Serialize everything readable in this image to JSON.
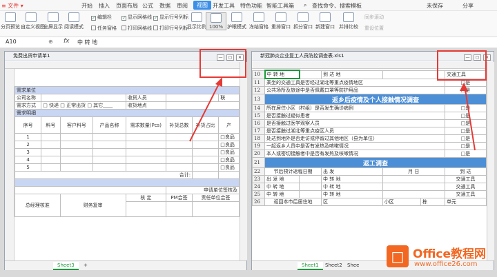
{
  "menubar": {
    "items": [
      "开始",
      "插入",
      "页面布局",
      "公式",
      "数据",
      "审阅",
      "视图",
      "开发工具",
      "特色功能",
      "智能工具箱"
    ],
    "active": "视图",
    "search": "查找命令、搜索模板",
    "status": "未保存",
    "share": "分享"
  },
  "ribbon": {
    "buttons": [
      "分页预览",
      "自定义视图",
      "全屏显示",
      "阅读模式",
      "护眼模式",
      "冻结窗格",
      "重排窗口",
      "拆分窗口",
      "新建窗口",
      "并排比较"
    ],
    "checks": [
      "编辑栏",
      "显示网格线",
      "显示行号列标",
      "任务窗格",
      "打印网格线",
      "打印行号列标"
    ],
    "zoom": "100%",
    "zoom_label": "显示比例",
    "sync": "同步滚动",
    "reset": "重设位置"
  },
  "formula": {
    "cell": "A10",
    "fx": "fx",
    "value": "中 转 地"
  },
  "left": {
    "title": "免费出货申请单1",
    "tab": "Sheet3",
    "cols": [
      "A",
      "B",
      "C",
      "D",
      "E",
      "F",
      "G",
      "H"
    ],
    "section1": "需求单位",
    "company": "公司名称",
    "recv": "收货人员",
    "contact": "联",
    "demand": "需求方式",
    "demand_opts": "□ 快递  □ 正常出货  □ 其它____",
    "addr": "收货地点",
    "section2": "需求明细",
    "heads": [
      "序号",
      "料号",
      "客户料号",
      "产品名称",
      "需求数量(Pcs)",
      "补货总数",
      "补货占比",
      "产"
    ],
    "rows": [
      "1",
      "2",
      "3",
      "4",
      "5"
    ],
    "good": "□良品",
    "total": "合计:",
    "sign": "申请单位签核及",
    "gm": "总经理核准",
    "fin": "财务复审",
    "check": "核 定",
    "pm": "PM会签",
    "resp": "责任单位会签"
  },
  "right": {
    "title": "新冠肺炎企业复工人员防控调查表.xls1",
    "tabs": [
      "Sheet1",
      "Sheet2",
      "Shee"
    ],
    "cols": [
      "C",
      "D",
      "E",
      "F",
      "G",
      "H",
      "I",
      "J"
    ],
    "r10": [
      "中 转 地",
      "到 达 地",
      "交通工具"
    ],
    "rows": [
      {
        "n": "11",
        "t": "乘坐的交通工具是否经过湖北等重点疫情地区",
        "c": "□是"
      },
      {
        "n": "12",
        "t": "公共场所及旅途中是否佩戴口罩等防护用品",
        "c": "□是"
      },
      {
        "n": "13",
        "t": "返乡后疫情及个人接触情况调查",
        "c": "",
        "h": true
      },
      {
        "n": "14",
        "t": "所在居住小区（村组）是否发生确诊病例",
        "c": "□是"
      },
      {
        "n": "15",
        "t": "是否接触过疑似患者",
        "c": "□是"
      },
      {
        "n": "16",
        "t": "是否接触过医学观察人员",
        "c": "□是"
      },
      {
        "n": "17",
        "t": "是否接触过湖北等重点疫区人员",
        "c": "□是"
      },
      {
        "n": "18",
        "t": "处达到地外是否走访或停留过其他地区（县为单位）",
        "c": "□是"
      },
      {
        "n": "19",
        "t": "一起返乡人员中是否有发热及咳嗽情况",
        "c": "□是"
      },
      {
        "n": "20",
        "t": "本人或密切接触者中是否有发热及咳嗽情况",
        "c": "□是"
      },
      {
        "n": "21",
        "t": "返工调查",
        "c": "",
        "h": true
      }
    ],
    "r22": [
      "节后预计返程日期",
      "出 发",
      "月 日",
      "到 达"
    ],
    "r23": [
      "出 发 地",
      "中 转 地",
      "交通工具"
    ],
    "r24": [
      "中 转 地",
      "中 转 地",
      "交通工具"
    ],
    "r25": [
      "中 转 地",
      "中 转 地",
      "交通工具"
    ],
    "r26": [
      "返回本市后居住地",
      "区",
      "小区",
      "栋",
      "单元"
    ]
  },
  "watermark": {
    "line1": "Office教程网",
    "line2": "www.office26.com"
  }
}
